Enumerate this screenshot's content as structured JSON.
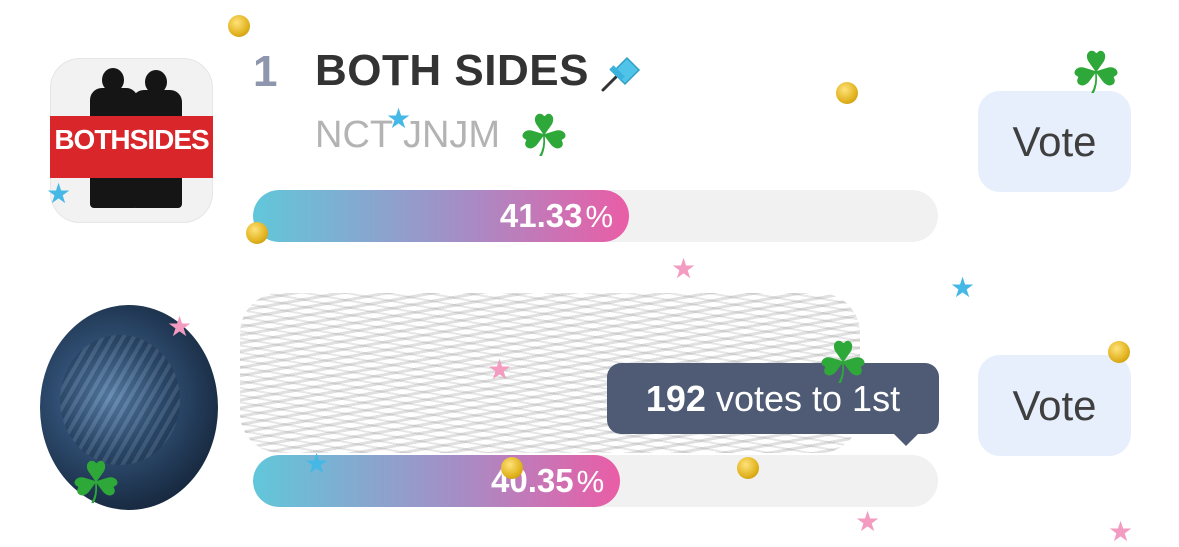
{
  "entries": [
    {
      "rank": "1",
      "title": "BOTH SIDES",
      "artist": "NCT JNJM",
      "album_art_text": "BOTHSIDES",
      "percent_value": "41.33",
      "percent_symbol": "%",
      "share": 0.4133,
      "pinned": true,
      "vote_label": "Vote"
    },
    {
      "rank": "",
      "title": "",
      "artist": "",
      "percent_value": "40.35",
      "percent_symbol": "%",
      "share": 0.4035,
      "vote_label": "Vote",
      "tooltip": {
        "votes": "192",
        "text": "votes to 1st"
      }
    }
  ],
  "colors": {
    "bar_start": "#61c7da",
    "bar_end": "#ea5da6",
    "vote_bg": "#e7eefc",
    "tooltip_bg": "#4f5b75",
    "pin": "#4fc3e8"
  },
  "icons": {
    "pin": "pin-icon",
    "decorations": [
      "clover-sticker",
      "gold-coin",
      "blue-star",
      "pink-star"
    ]
  }
}
